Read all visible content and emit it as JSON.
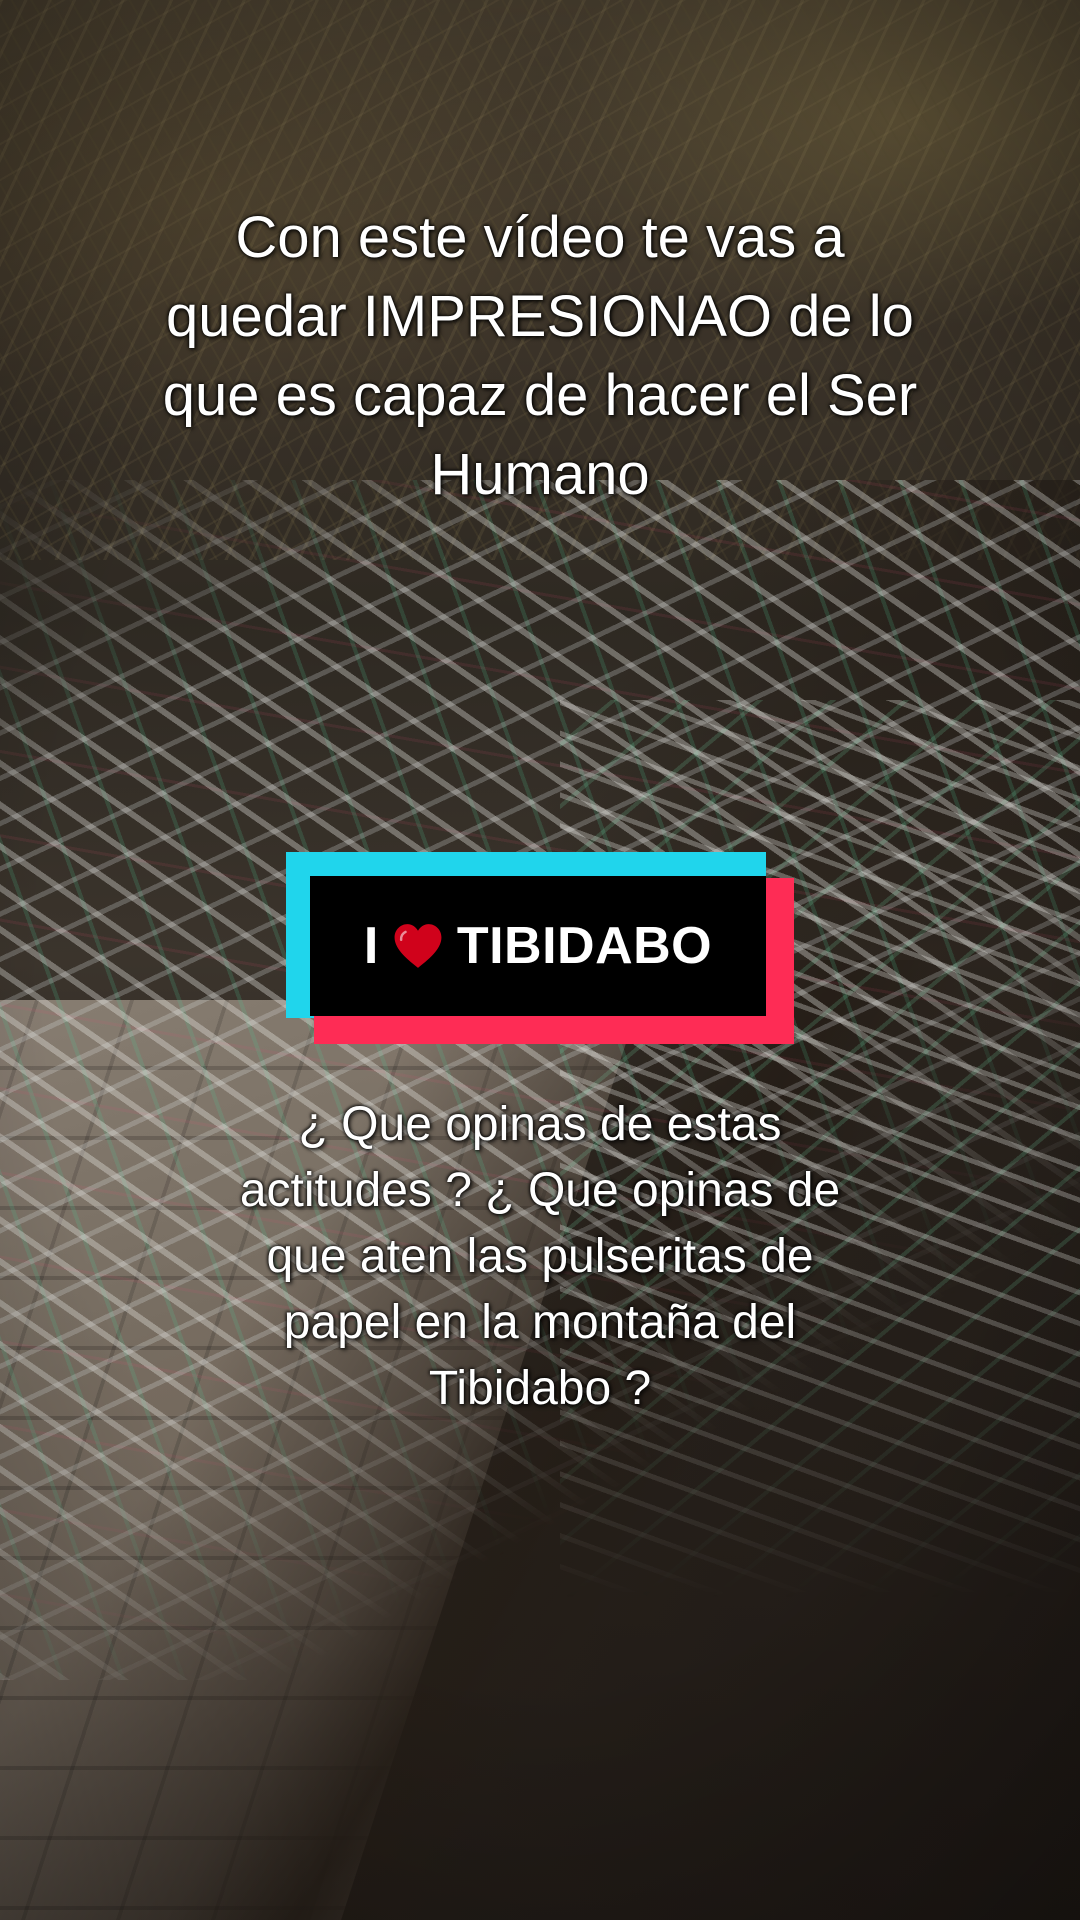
{
  "caption_top": {
    "lines": [
      "Con este vídeo te vas a",
      "quedar IMPRESIONAO de lo",
      "que es capaz de hacer el Ser",
      "Humano"
    ]
  },
  "sticker": {
    "prefix": "I",
    "icon": "red-heart-icon",
    "suffix": "TIBIDABO",
    "colors": {
      "cyan": "#20d5ec",
      "pink": "#fe2c55",
      "box": "#000000",
      "heart": "#d0021b"
    }
  },
  "caption_bottom": {
    "lines": [
      "¿ Que opinas de estas",
      "actitudes ? ¿ Que opinas de",
      "que aten las pulseritas de",
      "papel en la montaña del",
      "Tibidabo ?"
    ]
  }
}
